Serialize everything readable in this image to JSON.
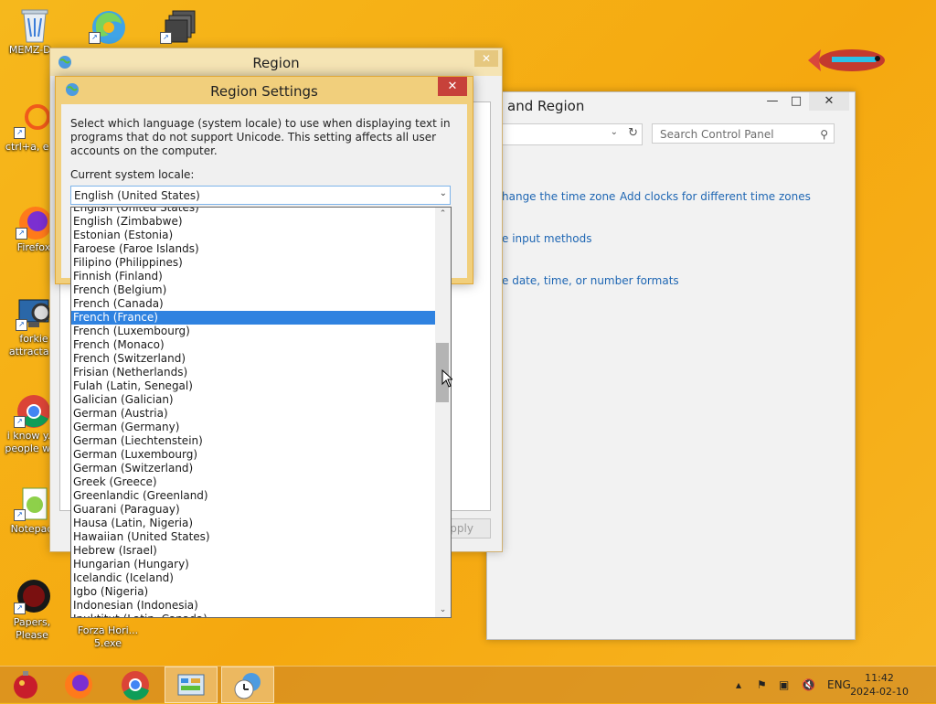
{
  "desktop": {
    "icons": [
      {
        "name": "recycle-bin-icon",
        "label": "MEMZ-D..."
      },
      {
        "name": "edge-icon",
        "label": ""
      },
      {
        "name": "app-icon",
        "label": ""
      },
      {
        "name": "ctrl-a-icon",
        "label": "ctrl+a, e..."
      },
      {
        "name": "firefox-icon",
        "label": "Firefox"
      },
      {
        "name": "settings-app-icon",
        "label": "forkie attracta..."
      },
      {
        "name": "chrome-icon",
        "label": "i know y... people w..."
      },
      {
        "name": "notepad-icon",
        "label": "Notepad"
      },
      {
        "name": "papers-please-icon",
        "label": "Papers, Please"
      }
    ],
    "forza_label": "Forza Hori... 5.exe"
  },
  "control_panel": {
    "title": "and Region",
    "search_placeholder": "Search Control Panel",
    "links": [
      "hange the time zone",
      "Add clocks for different time zones",
      "e input methods",
      "e date, time, or number formats"
    ]
  },
  "region_dialog": {
    "title": "Region",
    "apply_label": "Apply"
  },
  "region_settings": {
    "title": "Region Settings",
    "description": "Select which language (system locale) to use when displaying text in programs that do not support Unicode. This setting affects all user accounts on the computer.",
    "locale_label": "Current system locale:",
    "selected_value": "English (United States)",
    "dropdown_items": [
      "English (United States)",
      "English (Zimbabwe)",
      "Estonian (Estonia)",
      "Faroese (Faroe Islands)",
      "Filipino (Philippines)",
      "Finnish (Finland)",
      "French (Belgium)",
      "French (Canada)",
      "French (France)",
      "French (Luxembourg)",
      "French (Monaco)",
      "French (Switzerland)",
      "Frisian (Netherlands)",
      "Fulah (Latin, Senegal)",
      "Galician (Galician)",
      "German (Austria)",
      "German (Germany)",
      "German (Liechtenstein)",
      "German (Luxembourg)",
      "German (Switzerland)",
      "Greek (Greece)",
      "Greenlandic (Greenland)",
      "Guarani (Paraguay)",
      "Hausa (Latin, Nigeria)",
      "Hawaiian (United States)",
      "Hebrew (Israel)",
      "Hungarian (Hungary)",
      "Icelandic (Iceland)",
      "Igbo (Nigeria)",
      "Indonesian (Indonesia)",
      "Inuktitut (Latin, Canada)"
    ],
    "highlighted_item": "French (France)"
  },
  "taskbar": {
    "language": "ENG",
    "time": "11:42",
    "date": "2024-02-10"
  },
  "colors": {
    "desktop": "#f6b81c",
    "selection": "#2f82e0",
    "close_button": "#c7413a"
  }
}
